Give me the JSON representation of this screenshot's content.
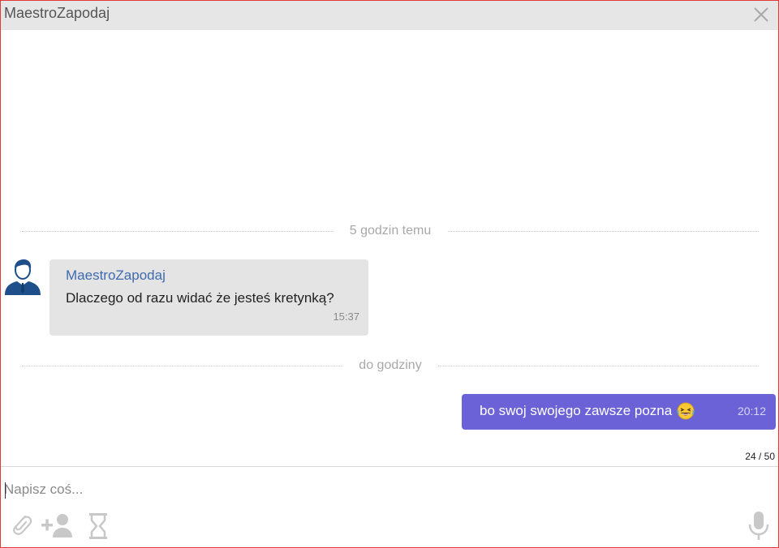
{
  "window": {
    "title": "MaestroZapodaj",
    "colors": {
      "border": "#e53935",
      "titlebar": "#e6e6e6",
      "outgoing_bubble": "#6a62d6",
      "incoming_bubble": "#e4e4e4",
      "sender_name": "#3f6bb0"
    }
  },
  "dividers": [
    {
      "label": "5 godzin temu"
    },
    {
      "label": "do godziny"
    }
  ],
  "messages": {
    "incoming": {
      "sender": "MaestroZapodaj",
      "text": "Dlaczego od razu widać że jesteś kretynką?",
      "time": "15:37",
      "avatar_icon": "user-suit-icon"
    },
    "outgoing": {
      "text": "bo swoj swojego zawsze pozna",
      "emoji": "laughing-emoji-icon",
      "time": "20:12"
    }
  },
  "composer": {
    "char_counter": "24 / 50",
    "placeholder": "Napisz coś...",
    "value": "",
    "tools": {
      "attach": "paperclip-icon",
      "add_user": "add-user-icon",
      "timer": "hourglass-icon",
      "voice": "microphone-icon"
    }
  }
}
